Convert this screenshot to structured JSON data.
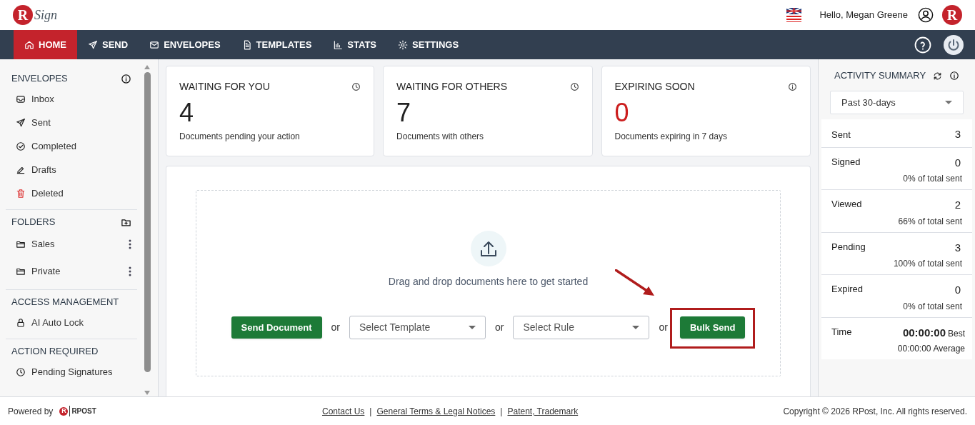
{
  "header": {
    "logo": {
      "mark": "R",
      "word": "Sign"
    },
    "greeting": "Hello, Megan Greene",
    "avatar": "R"
  },
  "nav": [
    {
      "label": "HOME",
      "kind": "home",
      "selected": true
    },
    {
      "label": "SEND",
      "kind": "send",
      "selected": false
    },
    {
      "label": "ENVELOPES",
      "kind": "envelope",
      "selected": false
    },
    {
      "label": "TEMPLATES",
      "kind": "template",
      "selected": false
    },
    {
      "label": "STATS",
      "kind": "stats",
      "selected": false
    },
    {
      "label": "SETTINGS",
      "kind": "settings",
      "selected": false
    }
  ],
  "sidebar": [
    {
      "title": "ENVELOPES",
      "kind": "info",
      "items": [
        {
          "label": "Inbox",
          "kind": "inbox"
        },
        {
          "label": "Sent",
          "kind": "send"
        },
        {
          "label": "Completed",
          "kind": "check"
        },
        {
          "label": "Drafts",
          "kind": "edit"
        },
        {
          "label": "Deleted",
          "kind": "trash"
        }
      ]
    },
    {
      "title": "FOLDERS",
      "kind": "add-folder",
      "items": [
        {
          "label": "Sales",
          "kind": "folder"
        },
        {
          "label": "Private",
          "kind": "folder"
        }
      ]
    },
    {
      "title": "ACCESS MANAGEMENT",
      "items": [
        {
          "label": "AI Auto Lock",
          "kind": "lock"
        }
      ]
    },
    {
      "title": "ACTION REQUIRED",
      "items": [
        {
          "label": "Pending Signatures",
          "kind": "clock"
        }
      ]
    }
  ],
  "cards": [
    {
      "title": "WAITING FOR YOU",
      "value": "4",
      "caption": "Documents pending your action",
      "color": "#222222",
      "kind": "clock"
    },
    {
      "title": "WAITING FOR OTHERS",
      "value": "7",
      "caption": "Documents with others",
      "color": "#222222",
      "kind": "clock"
    },
    {
      "title": "EXPIRING SOON",
      "value": "0",
      "caption": "Documents expiring in 7 days",
      "color": "#cc1f1f",
      "kind": "info"
    }
  ],
  "upload": {
    "prompt": "Drag and drop documents here to get started",
    "send_button": "Send Document",
    "template_select": {
      "placeholder": "Select Template"
    },
    "rule_select": {
      "placeholder": "Select Rule"
    },
    "separators": [
      "or",
      "or",
      "or"
    ],
    "bulk_button": "Bulk Send"
  },
  "activity": {
    "title": "ACTIVITY SUMMARY",
    "period": "Past 30-days",
    "rows": [
      {
        "kind": "stat",
        "label": "Sent",
        "value": "3"
      },
      {
        "kind": "stat",
        "label": "Signed",
        "value": "0",
        "note": "0% of total sent"
      },
      {
        "kind": "stat",
        "label": "Viewed",
        "value": "2",
        "note": "66% of total sent"
      },
      {
        "kind": "stat",
        "label": "Pending",
        "value": "3",
        "note": "100% of total sent"
      },
      {
        "kind": "stat",
        "label": "Expired",
        "value": "0",
        "note": "0% of total sent"
      },
      {
        "kind": "time",
        "label": "Time",
        "best": "00:00:00",
        "best_label": "Best",
        "average": "00:00:00",
        "average_label": "Average"
      }
    ]
  },
  "footer": {
    "powered_by": "Powered by",
    "logo": {
      "mark": "R",
      "word": "RPOST"
    },
    "links": [
      "Contact Us",
      "General Terms & Legal Notices",
      "Patent, Trademark"
    ],
    "separators": [
      "|",
      "|"
    ],
    "copyright": "Copyright © 2026 RPost, Inc. All rights reserved."
  }
}
